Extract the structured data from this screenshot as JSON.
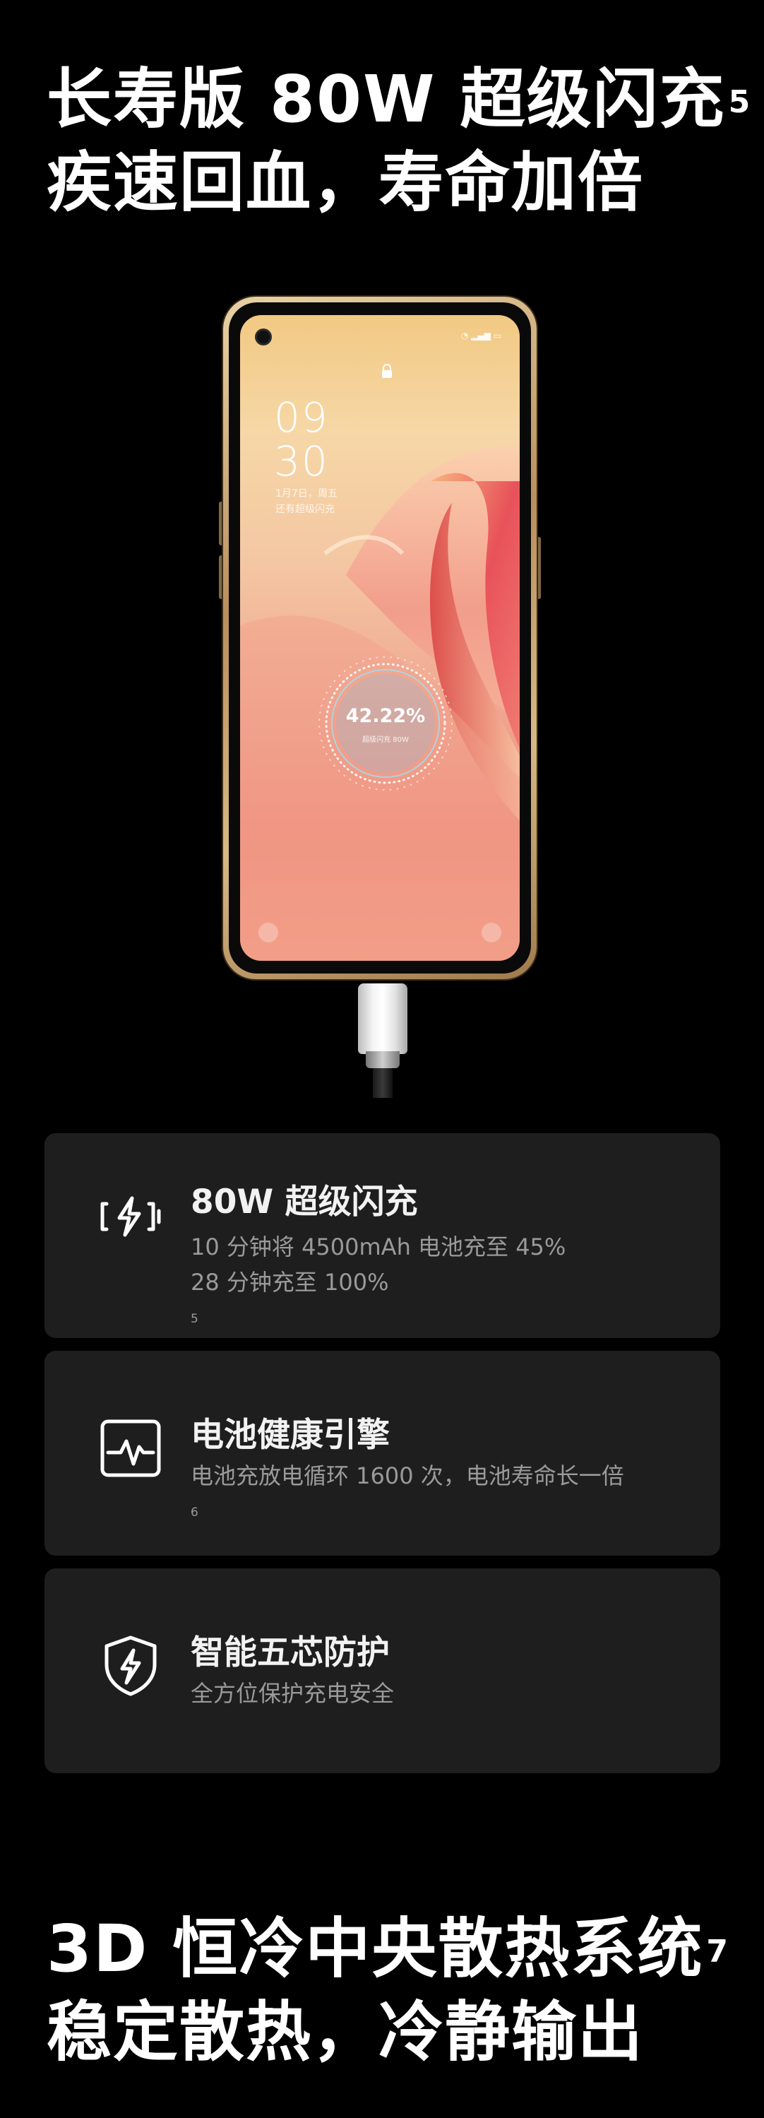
{
  "hero": {
    "line1": "长寿版 80W 超级闪充",
    "line1_sup": "5",
    "line2": "疾速回血，寿命加倍"
  },
  "phone": {
    "clock_hour": "09",
    "clock_minute": "30",
    "date_line1": "1月7日，周五",
    "date_line2": "还有超级闪充",
    "charge_percent": "42.22%",
    "charge_label": "超级闪充 80W"
  },
  "features": [
    {
      "icon": "charging-bolt-icon",
      "title": "80W 超级闪充",
      "desc_line1": "10 分钟将 4500mAh 电池充至 45%",
      "desc_line2": "28 分钟充至 100%",
      "desc_line2_sup": "5"
    },
    {
      "icon": "battery-health-icon",
      "title": "电池健康引擎",
      "desc_line1": "电池充放电循环 1600 次，电池寿命长一倍",
      "desc_line1_sup": "6"
    },
    {
      "icon": "shield-bolt-icon",
      "title": "智能五芯防护",
      "desc_line1": "全方位保护充电安全"
    }
  ],
  "cooling": {
    "line1": "3D 恒冷中央散热系统",
    "line1_sup": "7",
    "line2": "稳定散热，冷静输出"
  }
}
